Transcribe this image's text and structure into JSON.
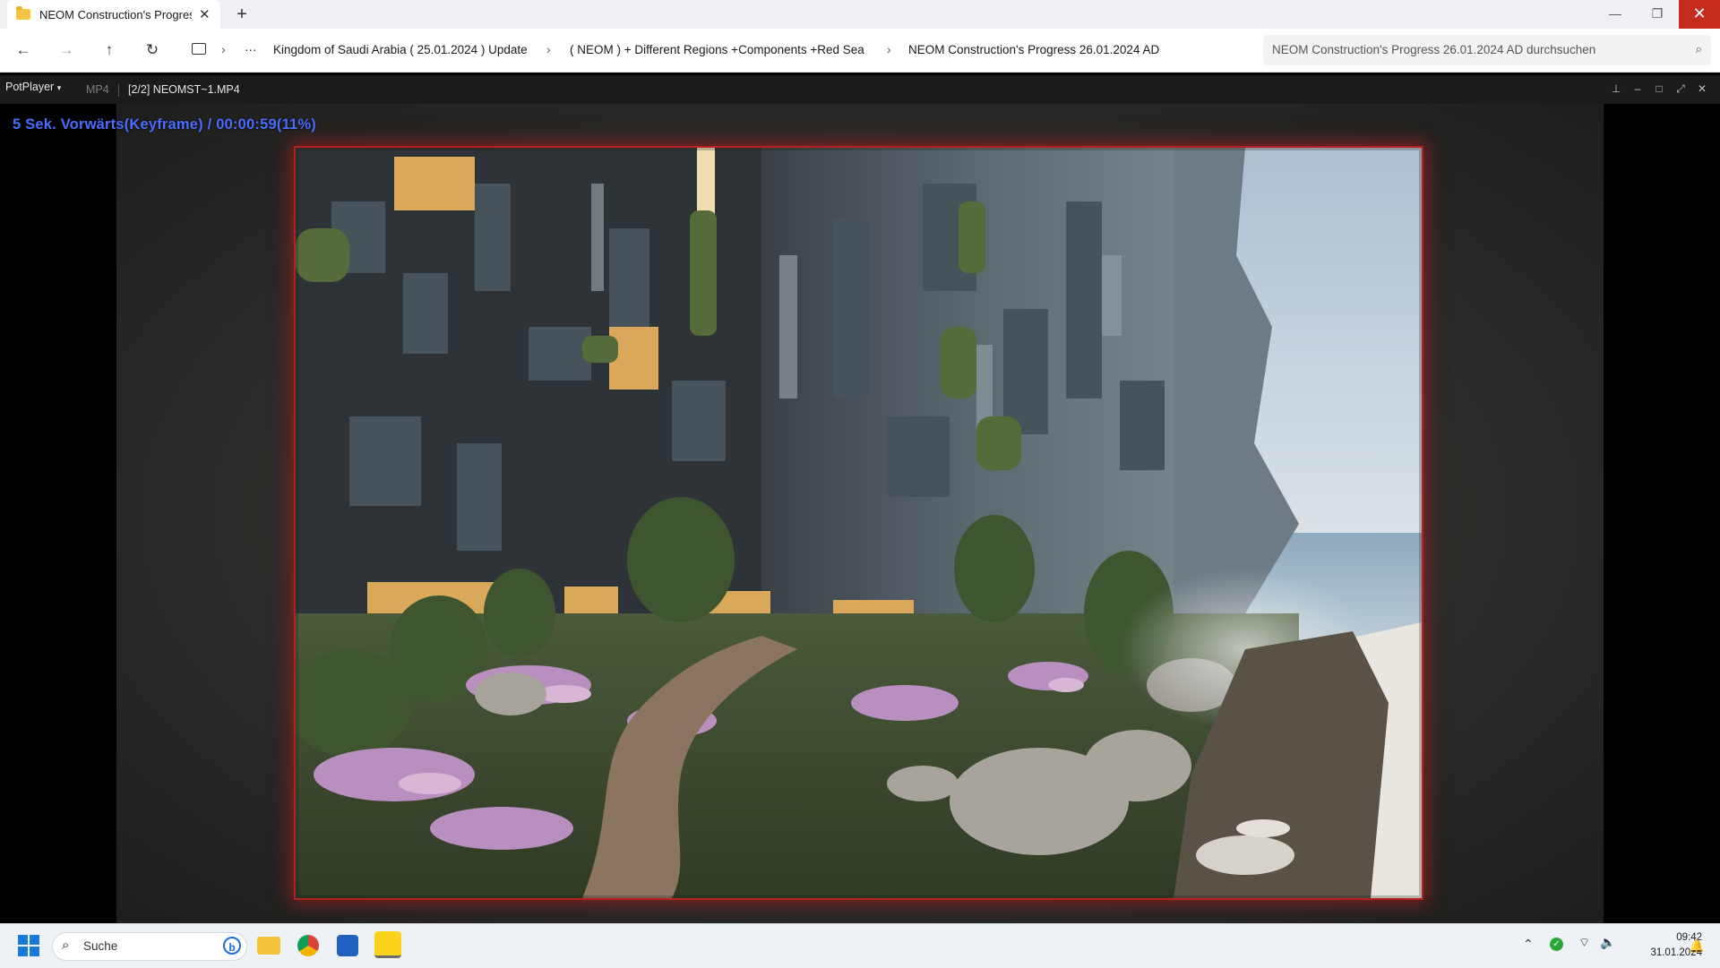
{
  "browser": {
    "tab_title": "NEOM Construction's Progress",
    "tab_close": "✕",
    "new_tab": "+",
    "window_controls": {
      "minimize": "—",
      "restore": "❐",
      "close": "✕"
    }
  },
  "explorer": {
    "nav": {
      "back": "←",
      "forward": "→",
      "up": "↑",
      "refresh": "↻",
      "more": "···"
    },
    "breadcrumbs": [
      "Kingdom of Saudi Arabia ( 25.01.2024 ) Update",
      "( NEOM ) + Different Regions +Components +Red Sea",
      "NEOM Construction's Progress 26.01.2024 AD"
    ],
    "search_placeholder": "NEOM Construction's Progress 26.01.2024 AD durchsuchen"
  },
  "player": {
    "menu_label": "PotPlayer",
    "format": "MP4",
    "file_label": "[2/2] NEOMST~1.MP4",
    "osd_text": "5  Sek. Vorwärts(Keyframe) / 00:00:59(11%)",
    "osd_color": "#4a6cff"
  },
  "taskbar": {
    "search_label": "Suche",
    "clock_time": "09:42",
    "clock_date": "31.01.2024"
  },
  "colors": {
    "accent_red": "#c42b1c",
    "frame_glow": "#b22020"
  }
}
